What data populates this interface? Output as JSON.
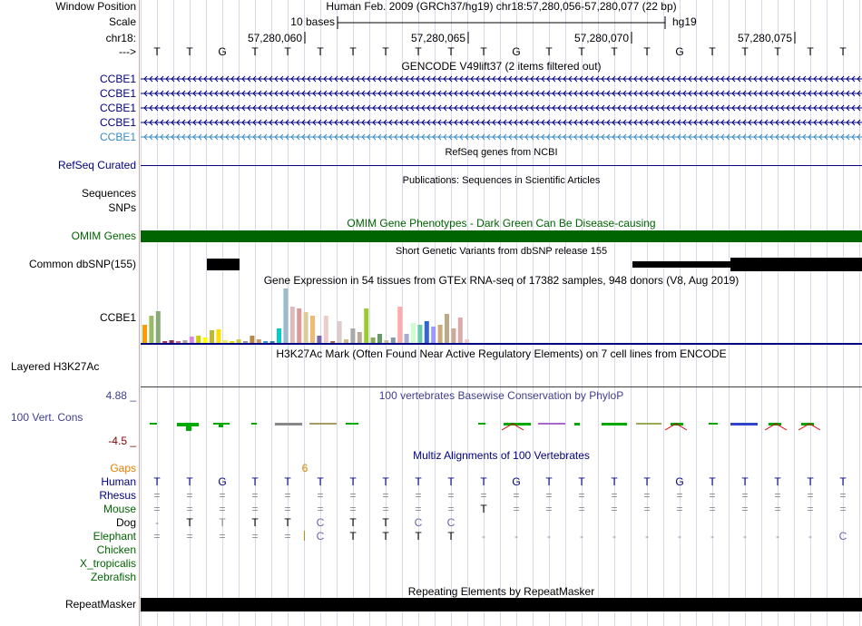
{
  "labels": {
    "window_position": "Window Position",
    "scale": "Scale",
    "chrom": "chr18:",
    "strand": "--->",
    "ccbe1": [
      "CCBE1",
      "CCBE1",
      "CCBE1",
      "CCBE1",
      "CCBE1"
    ],
    "refseq": "RefSeq Curated",
    "sequences": "Sequences",
    "snps": "SNPs",
    "omim": "OMIM Genes",
    "dbsnp": "Common dbSNP(155)",
    "gtex": "CCBE1",
    "h3k27ac": "Layered H3K27Ac",
    "cons_top": "4.88 _",
    "cons_name": "100 Vert. Cons",
    "cons_bot": "-4.5 _",
    "gaps": "Gaps",
    "species": [
      "Human",
      "Rhesus",
      "Mouse",
      "Dog",
      "Elephant",
      "Chicken",
      "X_tropicalis",
      "Zebrafish"
    ],
    "repeatmasker": "RepeatMasker"
  },
  "header": {
    "position": "Human Feb. 2009 (GRCh37/hg19)   chr18:57,280,056-57,280,077 (22 bp)",
    "scale_text": "10 bases",
    "assembly": "hg19",
    "ticks": [
      "57,280,060",
      "57,280,065",
      "57,280,070",
      "57,280,075"
    ]
  },
  "sequence": [
    "T",
    "T",
    "G",
    "T",
    "T",
    "T",
    "T",
    "T",
    "T",
    "T",
    "T",
    "G",
    "T",
    "T",
    "T",
    "T",
    "G",
    "T",
    "T",
    "T",
    "T",
    "T"
  ],
  "titles": {
    "gencode": "GENCODE V49lift37 (2 items filtered out)",
    "refseq": "RefSeq genes from NCBI",
    "publications": "Publications: Sequences in Scientific Articles",
    "omim": "OMIM Gene Phenotypes - Dark Green Can Be Disease-causing",
    "dbsnp": "Short Genetic Variants from dbSNP release 155",
    "gtex": "Gene Expression in 54 tissues from GTEx RNA-seq of 17382 samples, 948 donors (V8, Aug 2019)",
    "h3k27ac": "H3K27Ac Mark (Often Found Near Active Regulatory Elements) on 7 cell lines from ENCODE",
    "phylop": "100 vertebrates Basewise Conservation by PhyloP",
    "multiz": "Multiz Alignments of 100 Vertebrates",
    "repeatmasker": "Repeating Elements by RepeatMasker"
  },
  "gaps_value": "6",
  "multiz_rows": [
    [
      "T",
      "T",
      "G",
      "T",
      "T",
      "T",
      "T",
      "T",
      "T",
      "T",
      "T",
      "G",
      "T",
      "T",
      "T",
      "T",
      "G",
      "T",
      "T",
      "T",
      "T",
      "T"
    ],
    [
      "=",
      "=",
      "=",
      "=",
      "=",
      "=",
      "=",
      "=",
      "=",
      "=",
      "=",
      "=",
      "=",
      "=",
      "=",
      "=",
      "=",
      "=",
      "=",
      "=",
      "=",
      "="
    ],
    [
      "=",
      "=",
      "=",
      "=",
      "=",
      "=",
      "=",
      "=",
      "=",
      "=",
      "T",
      "=",
      "=",
      "=",
      "=",
      "=",
      "=",
      "=",
      "=",
      "=",
      "=",
      "="
    ],
    [
      "-",
      "T",
      "T",
      "T",
      "T",
      "C",
      "T",
      "T",
      "C",
      "C",
      "",
      "",
      "",
      "",
      "",
      "",
      "",
      "",
      "",
      "",
      "",
      ""
    ],
    [
      "=",
      "=",
      "=",
      "=",
      "=",
      "C",
      "T",
      "T",
      "T",
      "T",
      "-",
      "-",
      "-",
      "-",
      "-",
      "-",
      "-",
      "-",
      "-",
      "-",
      "-",
      "C"
    ]
  ],
  "colors": {
    "navy": "#000080",
    "omim_green": "#006400",
    "elephant_green": "#006400",
    "gaps_orange": "#e08000",
    "cons_label": "#404090",
    "cons_bottom": "#800000"
  }
}
